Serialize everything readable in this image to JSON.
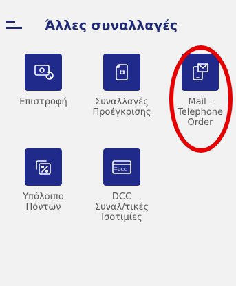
{
  "header": {
    "title": "Άλλες συναλλαγές",
    "menu_icon": "menu-icon"
  },
  "tiles": [
    {
      "id": "refund",
      "label": "Επιστροφή",
      "icon": "refund-icon"
    },
    {
      "id": "preauth",
      "label": "Συναλλαγές\nΠροέγκρισης",
      "icon": "preauth-icon"
    },
    {
      "id": "moto",
      "label": "Mail -\nTelephone\nOrder",
      "icon": "mail-phone-icon"
    },
    {
      "id": "points",
      "label": "Υπόλοιπο\nΠόντων",
      "icon": "points-balance-icon"
    },
    {
      "id": "dcc",
      "label": "DCC\nΣυναλ/τικές\nΙσοτιμίες",
      "icon": "dcc-card-icon",
      "icon_text": "DCC"
    }
  ],
  "colors": {
    "tile_bg": "#1f2a8a",
    "title": "#1e2a78",
    "label": "#555555",
    "highlight": "#e60000",
    "background": "#f2f2f2"
  }
}
